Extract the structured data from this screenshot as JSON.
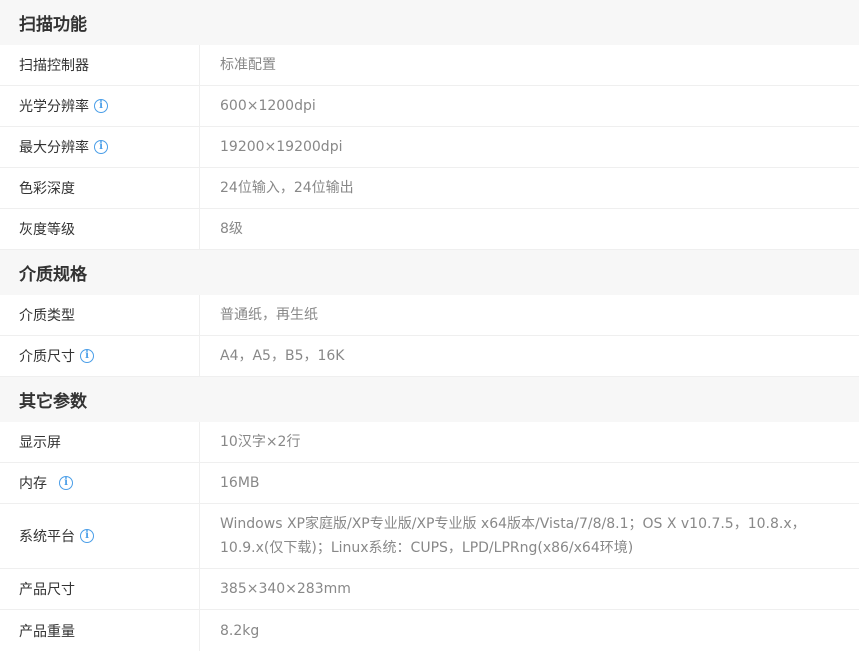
{
  "sections": [
    {
      "title": "扫描功能",
      "rows": [
        {
          "label": "扫描控制器",
          "value": "标准配置",
          "info": false
        },
        {
          "label": "光学分辨率",
          "value": "600×1200dpi",
          "info": true
        },
        {
          "label": "最大分辨率",
          "value": "19200×19200dpi",
          "info": true
        },
        {
          "label": "色彩深度",
          "value": "24位输入，24位输出",
          "info": false
        },
        {
          "label": "灰度等级",
          "value": "8级",
          "info": false
        }
      ]
    },
    {
      "title": "介质规格",
      "rows": [
        {
          "label": "介质类型",
          "value": "普通纸，再生纸",
          "info": false
        },
        {
          "label": "介质尺寸",
          "value": "A4，A5，B5，16K",
          "info": true
        }
      ]
    },
    {
      "title": "其它参数",
      "rows": [
        {
          "label": "显示屏",
          "value": "10汉字×2行",
          "info": false
        },
        {
          "label": "内存",
          "value": "16MB",
          "info": true
        },
        {
          "label": "系统平台",
          "value": "Windows XP家庭版/XP专业版/XP专业版 x64版本/Vista/7/8/8.1；OS X v10.7.5，10.8.x，10.9.x(仅下载)；Linux系统：CUPS，LPD/LPRng(x86/x64环境)",
          "info": true
        },
        {
          "label": "产品尺寸",
          "value": "385×340×283mm",
          "info": false
        },
        {
          "label": "产品重量",
          "value": "8.2kg",
          "info": false
        }
      ]
    }
  ],
  "info_icon": {
    "name": "info-icon",
    "glyph": "i",
    "color": "#4a9ee8"
  }
}
